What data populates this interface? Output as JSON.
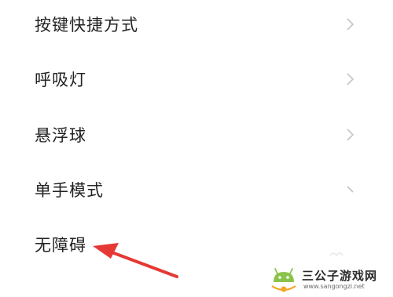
{
  "settings_list": {
    "items": [
      {
        "label": "按键快捷方式",
        "has_chevron": true
      },
      {
        "label": "呼吸灯",
        "has_chevron": true
      },
      {
        "label": "悬浮球",
        "has_chevron": true
      },
      {
        "label": "单手模式",
        "has_chevron": true
      },
      {
        "label": "无障碍",
        "has_chevron": false
      }
    ]
  },
  "annotation": {
    "arrow_color": "#e53935",
    "points_to": "无障碍"
  },
  "watermark": {
    "title": "三公子游戏网",
    "url": "www.sangongzi.net",
    "logo_icon": "android-robot-icon"
  },
  "colors": {
    "background": "#ffffff",
    "label_text": "#222222",
    "chevron": "#c4c4c4"
  }
}
